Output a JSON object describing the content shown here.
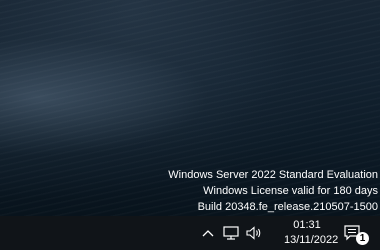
{
  "desktop": {
    "watermark": {
      "line1": "Windows Server 2022 Standard Evaluation",
      "line2": "Windows License valid for 180 days",
      "line3": "Build 20348.fe_release.210507-1500"
    }
  },
  "taskbar": {
    "tray": {
      "icons": [
        "chevron-up-icon",
        "network-icon",
        "volume-icon"
      ]
    },
    "clock": {
      "time": "01:31",
      "date": "13/11/2022"
    },
    "notifications": {
      "icon": "notification-center-icon",
      "count": "1"
    }
  },
  "colors": {
    "taskbar": "#101418",
    "text": "#ffffff"
  }
}
